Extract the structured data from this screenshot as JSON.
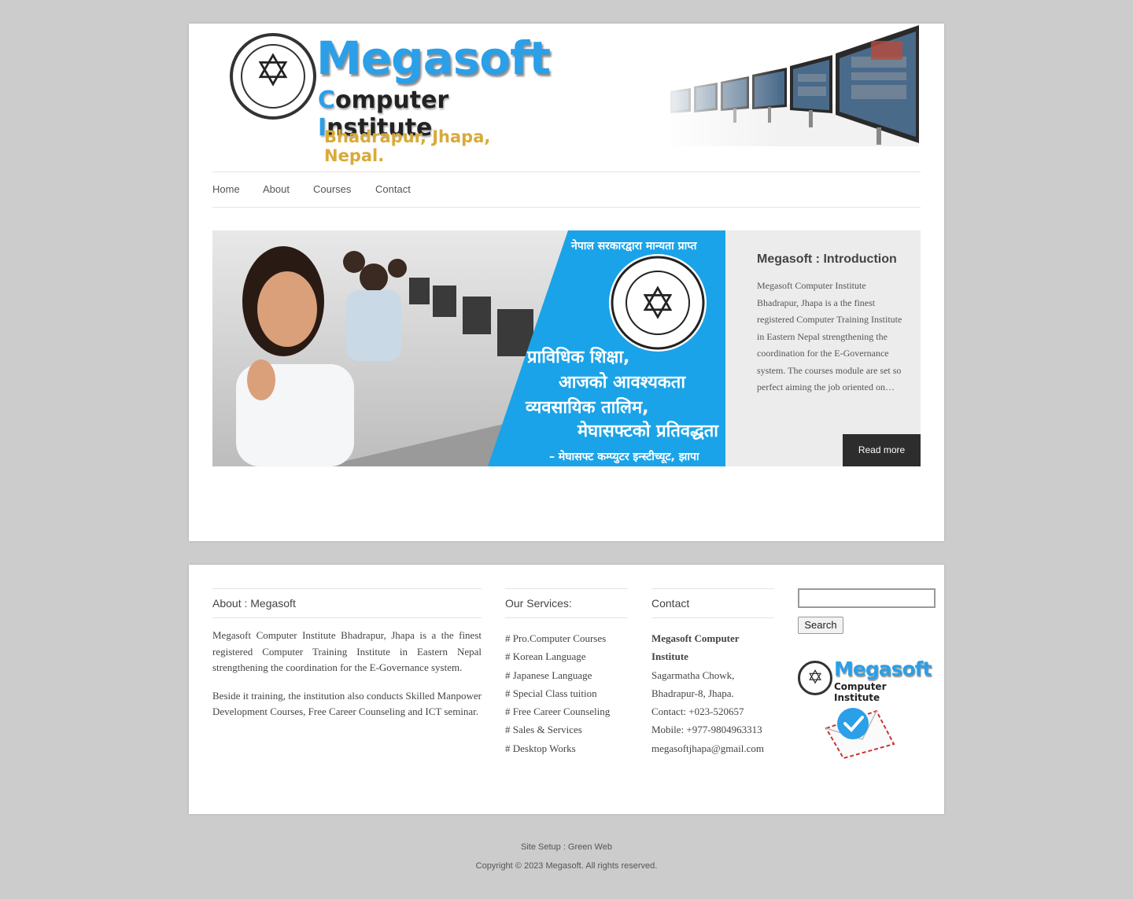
{
  "header": {
    "logo": {
      "word1": "Megasoft",
      "word2_c": "C",
      "word2_rest1": "omputer ",
      "word2_i": "I",
      "word2_rest2": "nstitute",
      "location": "Bhadrapur, Jhapa, Nepal."
    }
  },
  "nav": {
    "items": [
      {
        "label": "Home"
      },
      {
        "label": "About"
      },
      {
        "label": "Courses"
      },
      {
        "label": "Contact"
      }
    ]
  },
  "slider": {
    "banner": {
      "line_top": "नेपाल सरकारद्वारा मान्यता प्राप्त",
      "line1": "प्राविधिक शिक्षा,",
      "line2": "आजको आवश्यकता",
      "line3": "व्यवसायिक तालिम,",
      "line4": "मेघासफ्टको प्रतिवद्धता",
      "line_bottom": "– मेघासफ्ट कम्प्युटर इन्स्टीच्यूट, झापा"
    },
    "title": "Megasoft : Introduction",
    "text": "Megasoft Computer Institute Bhadrapur, Jhapa is a the finest registered Computer Training Institute in Eastern Nepal strengthening the coordination for the E-Governance system. The courses module are set so perfect aiming the job oriented on…",
    "read_more": "Read more"
  },
  "widgets": {
    "about": {
      "title": "About : Megasoft",
      "p1": "Megasoft Computer Institute Bhadrapur, Jhapa is a the finest registered Computer Training Institute in Eastern Nepal strengthening the coordination for the E-Governance system.",
      "p2": "Beside it training, the institution also conducts Skilled Manpower Development Courses, Free Career Counseling and ICT seminar."
    },
    "services": {
      "title": "Our Services:",
      "items": [
        "# Pro.Computer Courses",
        "# Korean Language",
        "# Japanese Language",
        "# Special Class tuition",
        "# Free Career Counseling",
        "# Sales & Services",
        "# Desktop Works"
      ]
    },
    "contact": {
      "title": "Contact",
      "name": "Megasoft Computer Institute",
      "lines": [
        "Sagarmatha Chowk,",
        "Bhadrapur-8, Jhapa.",
        "Contact: +023-520657",
        "Mobile: +977-9804963313",
        "megasoftjhapa@gmail.com"
      ]
    },
    "search": {
      "value": "",
      "button": "Search"
    },
    "mini_logo": {
      "word1": "Megasoft",
      "word2": "Computer Institute"
    }
  },
  "footer": {
    "setup": "Site Setup : Green Web",
    "copyright": "Copyright © 2023 Megasoft. All rights reserved."
  },
  "colors": {
    "background": "#cccccc",
    "brand_blue": "#2b9fe8",
    "button_dark": "#2d2d2d"
  }
}
